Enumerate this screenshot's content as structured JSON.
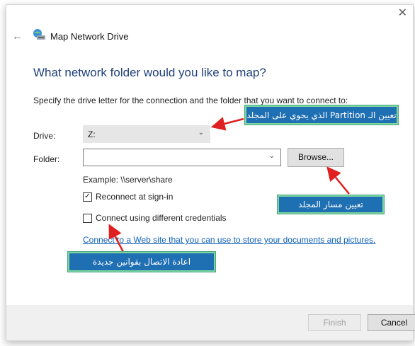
{
  "window": {
    "title": "Map Network Drive",
    "close_glyph": "✕",
    "back_glyph": "←"
  },
  "heading": "What network folder would you like to map?",
  "description": "Specify the drive letter for the connection and the folder that you want to connect to:",
  "drive": {
    "label": "Drive:",
    "value": "Z:",
    "chevron": "⌄"
  },
  "folder": {
    "label": "Folder:",
    "value": "",
    "chevron": "⌄",
    "browse_label": "Browse..."
  },
  "example": "Example: \\\\server\\share",
  "options": [
    {
      "label": "Reconnect at sign-in",
      "checked": true,
      "glyph": "✓"
    },
    {
      "label": "Connect using different credentials",
      "checked": false,
      "glyph": ""
    }
  ],
  "link": "Connect to a Web site that you can use to store your documents and pictures",
  "link_suffix": ".",
  "footer": {
    "finish_label": "Finish",
    "cancel_label": "Cancel"
  },
  "annotations": {
    "callout_partition": "تعيين الـ Partition الذي يحوي على المجلد",
    "callout_folder_path": "تعيين مسار المجلد",
    "callout_credentials": "اعادة الاتصال بقوانين جديدة",
    "callout_bg_color": "#1f6fb3",
    "callout_border_color": "#7dd6a2",
    "arrow_color": "#e02020"
  },
  "colors": {
    "heading": "#1f3f7a",
    "link": "#0c5fb8"
  }
}
